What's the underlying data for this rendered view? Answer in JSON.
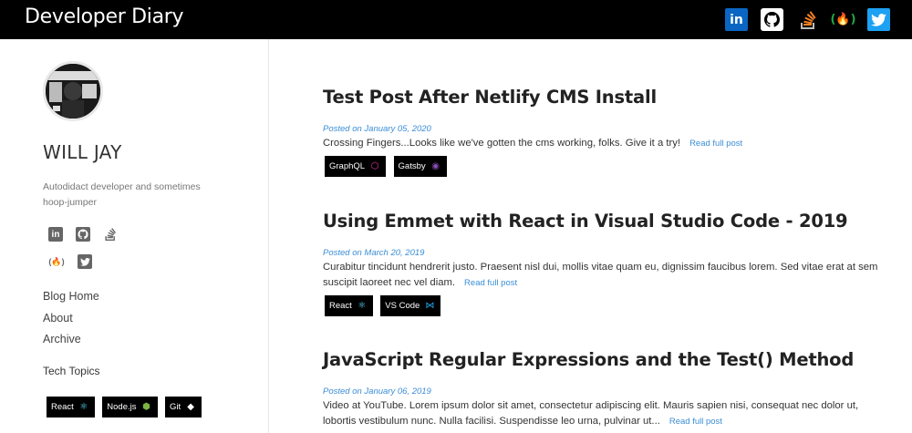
{
  "header": {
    "brand": "Developer Diary",
    "icons": [
      "linkedin-icon",
      "github-icon",
      "stackoverflow-icon",
      "freecodecamp-icon",
      "twitter-icon"
    ]
  },
  "sidebar": {
    "author": "WILL JAY",
    "bio": "Autodidact developer and sometimes hoop-jumper",
    "social_row1": [
      "linkedin-icon",
      "github-icon",
      "stackoverflow-icon"
    ],
    "social_row2": [
      "freecodecamp-icon",
      "twitter-icon"
    ],
    "nav": [
      {
        "label": "Blog Home"
      },
      {
        "label": "About"
      },
      {
        "label": "Archive"
      }
    ],
    "topics_title": "Tech Topics",
    "topics": [
      {
        "label": "React",
        "glyph": "⚛",
        "color": "#61dafb"
      },
      {
        "label": "Node.js",
        "glyph": "⬢",
        "color": "#7cb342"
      },
      {
        "label": "Git",
        "glyph": "◆",
        "color": "#ffffff"
      }
    ]
  },
  "posts": [
    {
      "title": "Test Post After Netlify CMS Install",
      "date": "Posted on January 05, 2020",
      "excerpt": "Crossing Fingers...Looks like we've gotten the cms working, folks. Give it a try!",
      "read_more": "Read full post",
      "tags": [
        {
          "label": "GraphQL",
          "glyph": "⬡",
          "color": "#e535ab"
        },
        {
          "label": "Gatsby",
          "glyph": "◉",
          "color": "#8a4baf"
        }
      ]
    },
    {
      "title": "Using Emmet with React in Visual Studio Code - 2019",
      "date": "Posted on March 20, 2019",
      "excerpt": "Curabitur tincidunt hendrerit justo. Praesent nisl dui, mollis vitae quam eu, dignissim faucibus lorem. Sed vitae erat at sem suscipit laoreet nec vel diam.",
      "read_more": "Read full post",
      "tags": [
        {
          "label": "React",
          "glyph": "⚛",
          "color": "#61dafb"
        },
        {
          "label": "VS Code",
          "glyph": "⋈",
          "color": "#23a9f2"
        }
      ]
    },
    {
      "title": "JavaScript Regular Expressions and the Test() Method",
      "date": "Posted on January 06, 2019",
      "excerpt": "Video at YouTube. Lorem ipsum dolor sit amet, consectetur adipiscing elit. Mauris sapien nisi, consequat nec dolor ut, lobortis vestibulum nunc. Nulla facilisi. Suspendisse leo urna, pulvinar ut...",
      "read_more": "Read full post",
      "tags": []
    }
  ],
  "colors": {
    "link": "#3b8ed6",
    "topbar": "#000000"
  }
}
